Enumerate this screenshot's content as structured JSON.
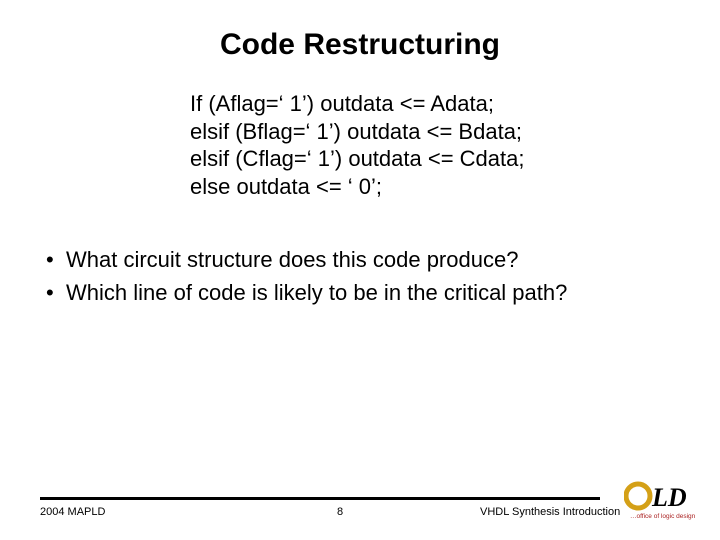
{
  "title": "Code Restructuring",
  "code": {
    "l1": "If (Aflag=‘ 1’) outdata <= Adata;",
    "l2": "elsif (Bflag=‘ 1’) outdata <= Bdata;",
    "l3": "elsif (Cflag=‘ 1’) outdata <= Cdata;",
    "l4": "else outdata <= ‘ 0’;"
  },
  "bullets": {
    "b1": "What circuit structure does this code produce?",
    "b2": "Which line of code is likely to be in the critical path?"
  },
  "footer": {
    "left": "2004 MAPLD",
    "center": "8",
    "right": "VHDL Synthesis Introduction"
  },
  "logo": {
    "primary_text": "LD",
    "tagline": "office of logic design",
    "colors": {
      "gold": "#d4a017",
      "red": "#aa2222",
      "black": "#000000"
    }
  }
}
